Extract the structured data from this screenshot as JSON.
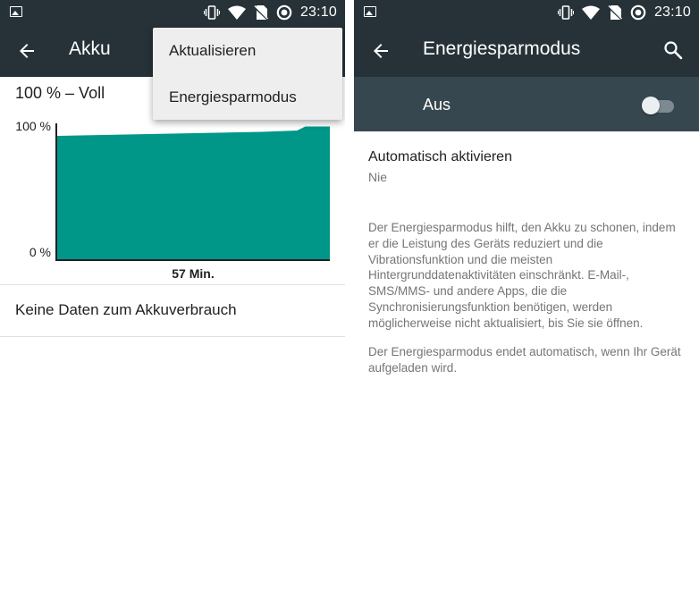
{
  "status_bar": {
    "time": "23:10",
    "icons": [
      "image-notification-icon",
      "vibrate-icon",
      "wifi-icon",
      "no-sim-icon",
      "battery-saver-ring-icon"
    ]
  },
  "left_screen": {
    "app_bar": {
      "title": "Akku",
      "back_icon": "back-arrow-icon"
    },
    "battery_status": "100 % – Voll",
    "chart_data": {
      "type": "area",
      "y_tick_labels": [
        "100 %",
        "0 %"
      ],
      "x_label": "57 Min.",
      "ylim": [
        0,
        100
      ],
      "series": [
        {
          "x_fraction": [
            0,
            0.25,
            0.5,
            0.75,
            0.88,
            0.91,
            1.0
          ],
          "values": [
            92,
            93,
            94,
            95,
            96,
            99,
            99
          ]
        }
      ],
      "color": "#009688"
    },
    "usage_message": "Keine Daten zum Akkuverbrauch",
    "overflow_menu": {
      "items": [
        {
          "label": "Aktualisieren"
        },
        {
          "label": "Energiesparmodus"
        }
      ]
    }
  },
  "right_screen": {
    "app_bar": {
      "title": "Energiesparmodus",
      "back_icon": "back-arrow-icon",
      "search_icon": "search-icon"
    },
    "master_switch": {
      "label": "Aus",
      "state": "off"
    },
    "auto_enable": {
      "title": "Automatisch aktivieren",
      "value": "Nie"
    },
    "description": [
      "Der Energiesparmodus hilft, den Akku zu schonen, indem er die Leistung des Geräts reduziert und die Vibrationsfunktion und die meisten Hintergrunddatenaktivitäten einschränkt. E-Mail-, SMS/MMS- und andere Apps, die die Synchronisierungsfunktion benötigen, werden möglicherweise nicht aktualisiert, bis Sie sie öffnen.",
      "Der Energiesparmodus endet automatisch, wenn Ihr Gerät aufgeladen wird."
    ]
  },
  "colors": {
    "toolbar": "#263238",
    "switch_bar": "#37474f",
    "accent": "#009688",
    "primary_text": "#212121",
    "secondary_text": "#757575",
    "menu_background": "#eeeeee"
  }
}
